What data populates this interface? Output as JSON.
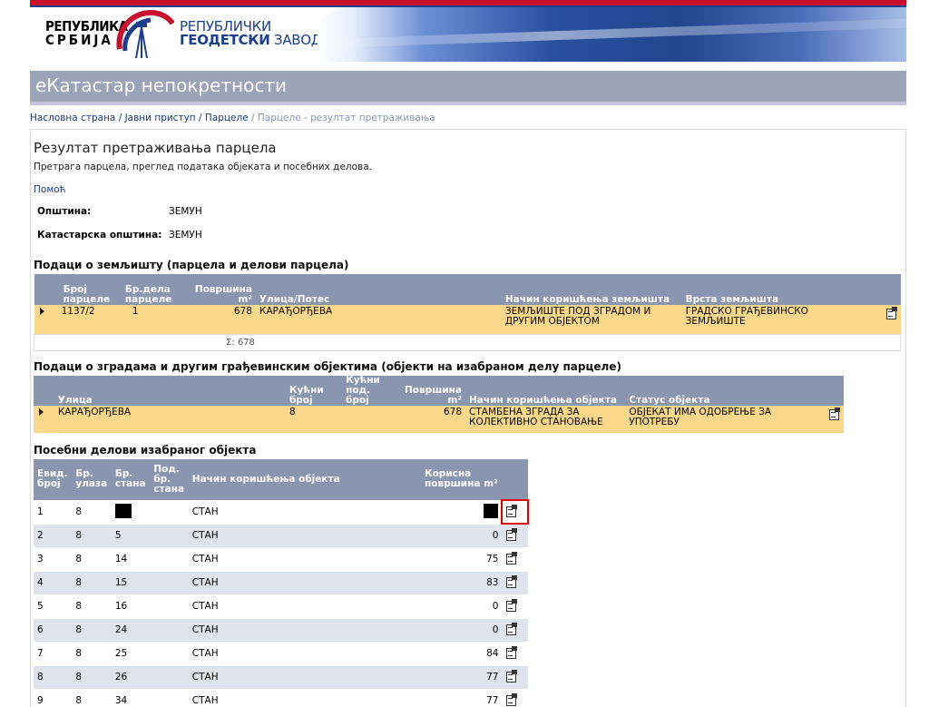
{
  "header": {
    "republic_line1": "РЕПУБЛИКА",
    "republic_line2": "СРБИЈА",
    "rgz_line1": "РЕПУБЛИЧКИ",
    "rgz_line2_bold": "ГЕОДЕТСКИ",
    "rgz_line2_rest": " ЗАВОД",
    "app_title": "еКатастар непокретности"
  },
  "breadcrumb": {
    "items": [
      "Насловна страна",
      "Јавни приступ",
      "Парцеле"
    ],
    "current": "Парцеле - резултат претраживања",
    "separator": " / "
  },
  "main": {
    "title": "Резултат претраживања парцела",
    "subtitle": "Претрага парцела, преглед података објеката и посебних делова.",
    "help_link": "Помоћ",
    "municipality_label": "Општина:",
    "municipality_value": "ЗЕМУН",
    "cadastral_label": "Катастарска општина:",
    "cadastral_value": "ЗЕМУН"
  },
  "land": {
    "section_title": "Подаци о земљишту (парцела и делови парцела)",
    "headers": {
      "parcel_no_1": "Број",
      "parcel_no_2": "парцеле",
      "part_no_1": "Бр.дела",
      "part_no_2": "парцеле",
      "area": "Површина m²",
      "street": "Улица/Потес",
      "usage": "Начин коришћења земљишта",
      "type": "Врста земљишта"
    },
    "row": {
      "parcel_no": "1137/2",
      "part_no": "1",
      "area": "678",
      "street": "КАРАЂОРЂЕВА",
      "usage": "ЗЕМЉИШТЕ ПОД ЗГРАДОМ И ДРУГИМ ОБЈЕКТОМ",
      "type": "ГРАДСКО ГРАЂЕВИНСКО ЗЕМЉИШТЕ"
    },
    "sum": "Σ: 678"
  },
  "buildings": {
    "section_title": "Подаци о зградама и другим грађевинским објектима (објекти на изабраном делу парцеле)",
    "headers": {
      "street": "Улица",
      "house_no_1": "Кућни",
      "house_no_2": "број",
      "house_sub_1": "Кућни под.",
      "house_sub_2": "број",
      "area_1": "Површина",
      "area_2": "m²",
      "usage": "Начин коришћења објекта",
      "status": "Статус објекта"
    },
    "row": {
      "street": "КАРАЂОРЂЕВА",
      "house_no": "8",
      "house_sub": "",
      "area": "678",
      "usage": "СТАМБЕНА ЗГРАДА ЗА КОЛЕКТИВНО СТАНОВАЊЕ",
      "status": "ОБЈЕКАТ ИМА ОДОБРЕЊЕ ЗА УПОТРЕБУ"
    }
  },
  "parts": {
    "section_title": "Посебни делови изабраног објекта",
    "headers": {
      "evid_1": "Евид.",
      "evid_2": "број",
      "entrance_1": "Бр.",
      "entrance_2": "улаза",
      "apt_1": "Бр.",
      "apt_2": "стана",
      "subapt_1": "Под.",
      "subapt_2": "бр.",
      "subapt_3": "стана",
      "usage": "Начин коришћења објекта",
      "area_1": "Корисна",
      "area_2": "површина m²"
    },
    "rows": [
      {
        "evid": "1",
        "entrance": "8",
        "apt": "",
        "usage": "СТАН",
        "area": "",
        "redacted": true
      },
      {
        "evid": "2",
        "entrance": "8",
        "apt": "5",
        "usage": "СТАН",
        "area": "0"
      },
      {
        "evid": "3",
        "entrance": "8",
        "apt": "14",
        "usage": "СТАН",
        "area": "75"
      },
      {
        "evid": "4",
        "entrance": "8",
        "apt": "15",
        "usage": "СТАН",
        "area": "83"
      },
      {
        "evid": "5",
        "entrance": "8",
        "apt": "16",
        "usage": "СТАН",
        "area": "0"
      },
      {
        "evid": "6",
        "entrance": "8",
        "apt": "24",
        "usage": "СТАН",
        "area": "0"
      },
      {
        "evid": "7",
        "entrance": "8",
        "apt": "25",
        "usage": "СТАН",
        "area": "84"
      },
      {
        "evid": "8",
        "entrance": "8",
        "apt": "26",
        "usage": "СТАН",
        "area": "77"
      },
      {
        "evid": "9",
        "entrance": "8",
        "apt": "34",
        "usage": "СТАН",
        "area": "77"
      }
    ]
  },
  "colors": {
    "header_bar": "#9aa3b8",
    "table_header": "#8a96b0",
    "selected_row": "#f9d88c",
    "alt_row": "#dfe3ec",
    "link": "#1a3a7a",
    "highlight_box": "#e00000"
  },
  "icons": {
    "details": "open-details-icon",
    "row_selector": "row-arrow-icon"
  }
}
